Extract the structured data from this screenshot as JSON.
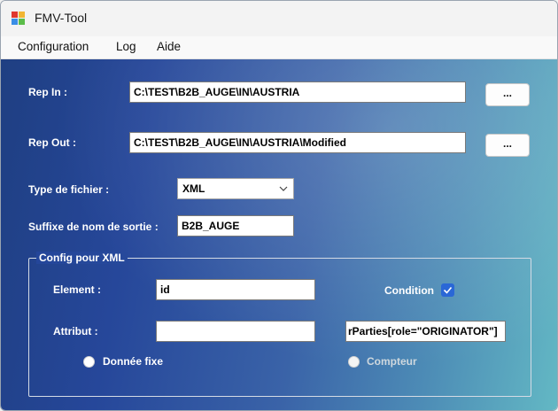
{
  "window": {
    "title": "FMV-Tool"
  },
  "menu": {
    "items": [
      "Configuration",
      "Log",
      "Aide"
    ]
  },
  "form": {
    "rep_in_label": "Rep In :",
    "rep_in_value": "C:\\TEST\\B2B_AUGE\\IN\\AUSTRIA",
    "rep_out_label": "Rep Out :",
    "rep_out_value": "C:\\TEST\\B2B_AUGE\\IN\\AUSTRIA\\Modified",
    "browse_label": "...",
    "type_label": "Type de fichier :",
    "type_value": "XML",
    "suffix_label": "Suffixe de nom de sortie :",
    "suffix_value": "B2B_AUGE"
  },
  "xml_group": {
    "title": "Config pour XML",
    "element_label": "Element :",
    "element_value": "id",
    "condition_label": "Condition",
    "condition_checked": true,
    "attribut_label": "Attribut :",
    "attribut_value": "",
    "condition_value": "rParties[role=\"ORIGINATOR\"]",
    "radio_fixed_label": "Donnée fixe",
    "radio_counter_label": "Compteur"
  }
}
